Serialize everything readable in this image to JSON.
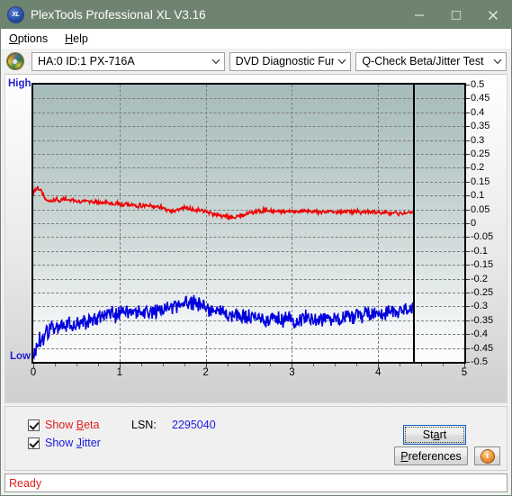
{
  "window": {
    "title": "PlexTools Professional XL V3.16",
    "icon": "xl-logo-icon",
    "minimize": "minimize-icon",
    "maximize": "maximize-icon",
    "close": "close-icon"
  },
  "menubar": {
    "items": [
      {
        "label": "Options",
        "accel": "O"
      },
      {
        "label": "Help",
        "accel": "H"
      }
    ]
  },
  "toolbar": {
    "disc_icon": "disc-icon",
    "drive": {
      "value": "HA:0 ID:1  PX-716A"
    },
    "function": {
      "value": "DVD Diagnostic Functions"
    },
    "test": {
      "value": "Q-Check Beta/Jitter Test"
    },
    "caret": "∨"
  },
  "chart": {
    "label_high": "High",
    "label_low": "Low",
    "marker_x": 4.4
  },
  "controls": {
    "show_beta": {
      "label_pre": "Show ",
      "accel": "B",
      "label_post": "eta",
      "checked": true
    },
    "show_jitter": {
      "label_pre": "Show ",
      "accel": "J",
      "label_post": "itter",
      "checked": true
    },
    "lsn_label": "LSN:",
    "lsn_value": "2295040",
    "start": {
      "pre": "St",
      "accel": "a",
      "post": "rt"
    },
    "preferences": {
      "pre": "",
      "accel": "P",
      "post": "references"
    },
    "info": {
      "glyph": "i",
      "name": "info-icon"
    }
  },
  "statusbar": {
    "text": "Ready"
  },
  "colors": {
    "titlebar": "#6f8470",
    "beta": "#ee0000",
    "jitter": "#0000dd",
    "accent_blue": "#1a1ae0",
    "status_red": "#e02020"
  },
  "chart_data": {
    "type": "line",
    "title": "",
    "xlabel": "",
    "ylabel": "",
    "xlim": [
      0,
      5
    ],
    "ylim": [
      -0.5,
      0.5
    ],
    "grid": true,
    "legend_position": "bottom-left",
    "xticks": [
      0,
      1,
      2,
      3,
      4,
      5
    ],
    "yticks": [
      0.5,
      0.45,
      0.4,
      0.35,
      0.3,
      0.25,
      0.2,
      0.15,
      0.1,
      0.05,
      0,
      -0.05,
      -0.1,
      -0.15,
      -0.2,
      -0.25,
      -0.3,
      -0.35,
      -0.4,
      -0.45,
      -0.5
    ],
    "left_axis_labels": [
      "High",
      "Low"
    ],
    "annotations": [
      {
        "type": "vline",
        "x": 4.4,
        "label": ""
      }
    ],
    "series": [
      {
        "name": "Show Beta",
        "color": "#ee0000",
        "noise": 0.006,
        "x": [
          0.0,
          0.04,
          0.08,
          0.12,
          0.16,
          0.2,
          0.25,
          0.3,
          0.35,
          0.4,
          0.5,
          0.6,
          0.7,
          0.8,
          0.9,
          1.0,
          1.1,
          1.2,
          1.3,
          1.4,
          1.5,
          1.55,
          1.6,
          1.65,
          1.7,
          1.75,
          1.8,
          1.85,
          1.9,
          2.0,
          2.1,
          2.2,
          2.3,
          2.4,
          2.5,
          2.6,
          2.7,
          2.8,
          2.9,
          3.0,
          3.1,
          3.2,
          3.3,
          3.4,
          3.5,
          3.6,
          3.7,
          3.8,
          3.9,
          4.0,
          4.1,
          4.2,
          4.3,
          4.4
        ],
        "y": [
          0.105,
          0.13,
          0.122,
          0.098,
          0.082,
          0.08,
          0.085,
          0.082,
          0.085,
          0.086,
          0.08,
          0.078,
          0.076,
          0.074,
          0.072,
          0.07,
          0.067,
          0.064,
          0.062,
          0.06,
          0.057,
          0.05,
          0.045,
          0.043,
          0.052,
          0.055,
          0.054,
          0.052,
          0.048,
          0.042,
          0.034,
          0.026,
          0.022,
          0.026,
          0.036,
          0.044,
          0.046,
          0.045,
          0.044,
          0.043,
          0.043,
          0.042,
          0.042,
          0.041,
          0.041,
          0.042,
          0.042,
          0.041,
          0.04,
          0.038,
          0.037,
          0.036,
          0.036,
          0.036
        ]
      },
      {
        "name": "Show Jitter",
        "color": "#0000dd",
        "noise": 0.022,
        "x": [
          0.0,
          0.03,
          0.06,
          0.1,
          0.14,
          0.18,
          0.22,
          0.26,
          0.3,
          0.35,
          0.4,
          0.45,
          0.5,
          0.55,
          0.6,
          0.65,
          0.7,
          0.75,
          0.8,
          0.85,
          0.9,
          0.95,
          1.0,
          1.1,
          1.2,
          1.3,
          1.4,
          1.5,
          1.55,
          1.6,
          1.65,
          1.7,
          1.75,
          1.8,
          1.85,
          1.9,
          1.95,
          2.0,
          2.1,
          2.2,
          2.3,
          2.4,
          2.5,
          2.6,
          2.7,
          2.8,
          2.9,
          3.0,
          3.1,
          3.2,
          3.3,
          3.4,
          3.5,
          3.6,
          3.7,
          3.8,
          3.9,
          4.0,
          4.1,
          4.2,
          4.3,
          4.4
        ],
        "y": [
          -0.47,
          -0.45,
          -0.43,
          -0.42,
          -0.4,
          -0.39,
          -0.38,
          -0.375,
          -0.372,
          -0.37,
          -0.368,
          -0.372,
          -0.366,
          -0.36,
          -0.352,
          -0.348,
          -0.345,
          -0.342,
          -0.34,
          -0.336,
          -0.332,
          -0.33,
          -0.328,
          -0.325,
          -0.322,
          -0.32,
          -0.322,
          -0.316,
          -0.3,
          -0.302,
          -0.305,
          -0.3,
          -0.288,
          -0.278,
          -0.282,
          -0.292,
          -0.3,
          -0.305,
          -0.312,
          -0.322,
          -0.33,
          -0.336,
          -0.34,
          -0.342,
          -0.344,
          -0.345,
          -0.346,
          -0.346,
          -0.345,
          -0.344,
          -0.343,
          -0.342,
          -0.34,
          -0.338,
          -0.334,
          -0.33,
          -0.326,
          -0.324,
          -0.32,
          -0.314,
          -0.31,
          -0.312
        ]
      }
    ]
  }
}
